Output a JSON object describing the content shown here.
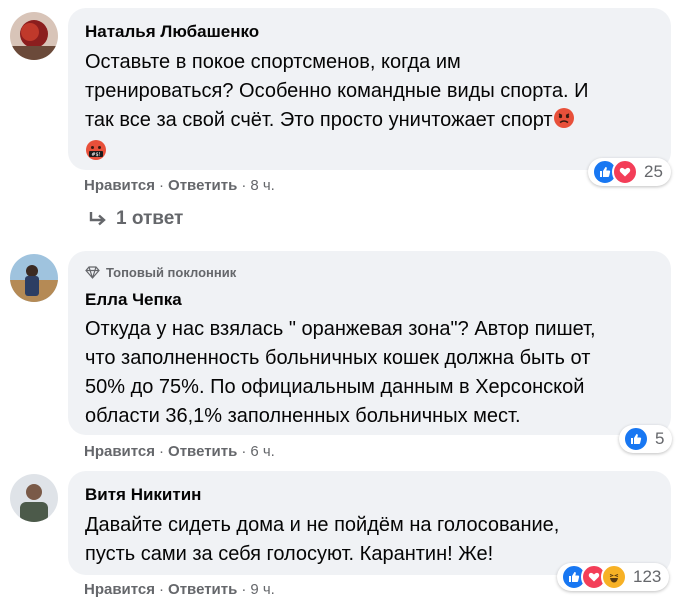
{
  "comments": [
    {
      "author": "Наталья Любашенко",
      "text_line1": "Оставьте в покое спортсменов, когда им",
      "text_line2": "тренироваться? Особенно командные виды спорта. И",
      "text_line3": "так все за свой счёт. Это просто уничтожает спорт",
      "like_label": "Нравится",
      "reply_label": "Ответить",
      "time": "8 ч.",
      "reaction_count": "25",
      "reaction_icons": [
        "like-icon",
        "love-icon"
      ],
      "replies_label": "1 ответ"
    },
    {
      "badge": "Топовый поклонник",
      "author": "Елла Чепка",
      "text_line1": "Откуда у нас взялась \" оранжевая зона\"? Автор пишет,",
      "text_line2": "что заполненность больничных кошек должна быть от",
      "text_line3": "50% до 75%. По официальным данным в Херсонской",
      "text_line4": "области 36,1% заполненных больничных мест.",
      "like_label": "Нравится",
      "reply_label": "Ответить",
      "time": "6 ч.",
      "reaction_count": "5",
      "reaction_icons": [
        "like-icon"
      ]
    },
    {
      "author": "Витя Никитин",
      "text_line1": "Давайте сидеть дома и не пойдём на голосование,",
      "text_line2": "пусть сами за себя голосуют. Карантин! Же!",
      "like_label": "Нравится",
      "reply_label": "Ответить",
      "time": "9 ч.",
      "reaction_count": "123",
      "reaction_icons": [
        "like-icon",
        "love-icon",
        "haha-icon"
      ]
    }
  ],
  "colors": {
    "bubble": "#f0f2f5",
    "meta_text": "#65676b",
    "like_blue": "#1877f2",
    "love_red": "#f33e58",
    "haha_yellow": "#f7b125"
  }
}
